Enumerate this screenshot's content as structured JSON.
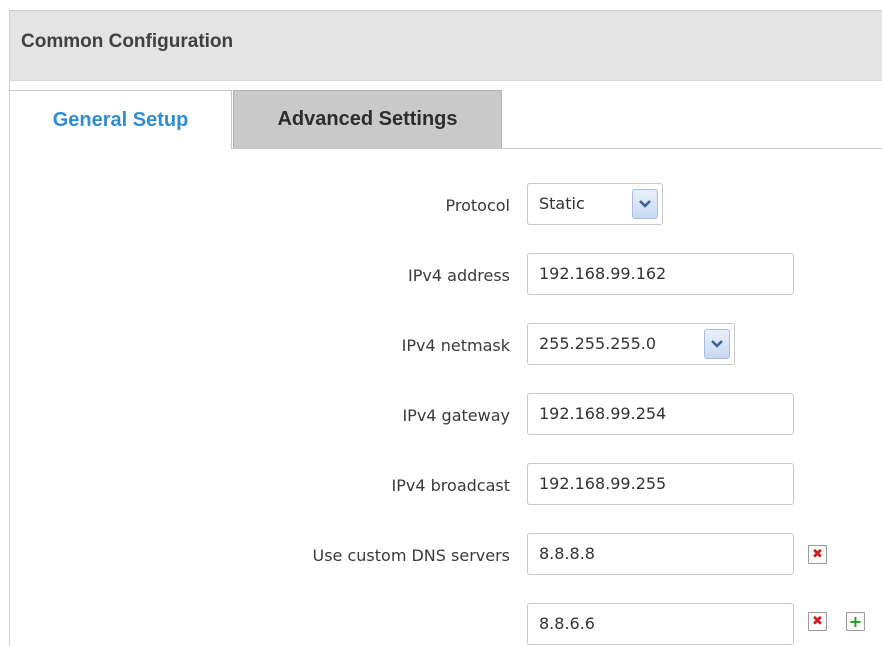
{
  "section": {
    "title": "Common Configuration"
  },
  "tabs": [
    {
      "label": "General Setup",
      "active": true
    },
    {
      "label": "Advanced Settings",
      "active": false
    }
  ],
  "form": {
    "protocol": {
      "label": "Protocol",
      "value": "Static"
    },
    "ipv4_address": {
      "label": "IPv4 address",
      "value": "192.168.99.162"
    },
    "ipv4_netmask": {
      "label": "IPv4 netmask",
      "value": "255.255.255.0"
    },
    "ipv4_gateway": {
      "label": "IPv4 gateway",
      "value": "192.168.99.254"
    },
    "ipv4_broadcast": {
      "label": "IPv4 broadcast",
      "value": "192.168.99.255"
    },
    "dns": {
      "label": "Use custom DNS servers",
      "servers": [
        "8.8.8.8",
        "8.8.6.6"
      ]
    }
  },
  "icons": {
    "dropdown": "chevron-down-icon",
    "remove": "remove-icon",
    "add": "add-icon"
  },
  "colors": {
    "active_tab_text": "#2f8dd0",
    "remove_icon": "#d21c1c",
    "add_icon": "#1f9a1f"
  }
}
